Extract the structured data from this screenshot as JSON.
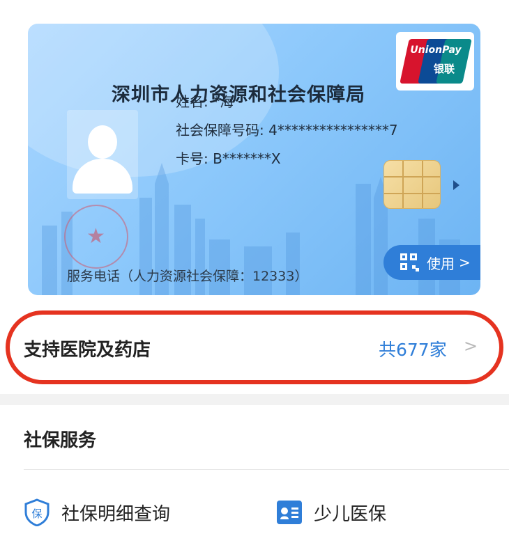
{
  "card": {
    "issuer": "深圳市人力资源和社会保障局",
    "unionpay_en": "UnionPay",
    "unionpay_cn": "银联",
    "name_line": "姓名: *海",
    "ssn_line": "社会保障号码: 4****************7",
    "card_no_line": "卡号: B*******X",
    "hotline": "服务电话（人力资源社会保障：12333）",
    "use_button": "使用",
    "use_chevron": ">"
  },
  "support": {
    "label": "支持医院及药店",
    "count": "共677家",
    "chevron": ">"
  },
  "services": {
    "title": "社保服务",
    "items": [
      {
        "label": "社保明细查询",
        "icon": "shield-bao-icon"
      },
      {
        "label": "少儿医保",
        "icon": "child-card-icon"
      }
    ]
  },
  "colors": {
    "accent": "#2f7ed8",
    "highlight": "#e53320"
  }
}
